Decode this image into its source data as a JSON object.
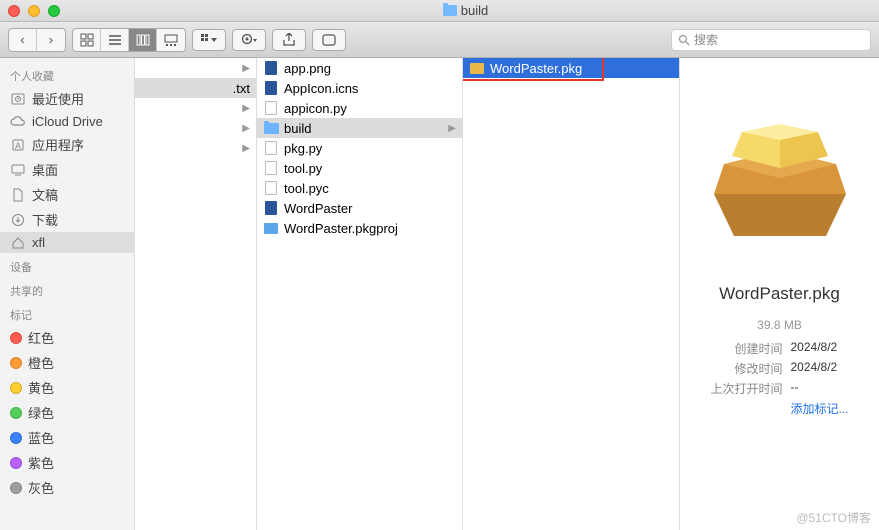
{
  "window": {
    "title": "build"
  },
  "toolbar": {
    "search_placeholder": "搜索"
  },
  "sidebar": {
    "sections": [
      {
        "heading": "个人收藏",
        "items": [
          {
            "label": "最近使用",
            "icon": "clock"
          },
          {
            "label": "iCloud Drive",
            "icon": "cloud"
          },
          {
            "label": "应用程序",
            "icon": "apps"
          },
          {
            "label": "桌面",
            "icon": "desktop"
          },
          {
            "label": "文稿",
            "icon": "doc"
          },
          {
            "label": "下载",
            "icon": "download"
          },
          {
            "label": "xfl",
            "icon": "home",
            "selected": true
          }
        ]
      },
      {
        "heading": "设备",
        "items": []
      },
      {
        "heading": "共享的",
        "items": []
      },
      {
        "heading": "标记",
        "items": [
          {
            "label": "红色",
            "color": "#ff5b51"
          },
          {
            "label": "橙色",
            "color": "#ff9a34"
          },
          {
            "label": "黄色",
            "color": "#ffcf2e"
          },
          {
            "label": "绿色",
            "color": "#56cf5a"
          },
          {
            "label": "蓝色",
            "color": "#3b82f6"
          },
          {
            "label": "紫色",
            "color": "#b560ff"
          },
          {
            "label": "灰色",
            "color": "#9e9e9e"
          }
        ]
      }
    ]
  },
  "columns": {
    "c1": [
      {
        "label": "",
        "arrow": true
      },
      {
        "label": ".txt",
        "arrow": false,
        "selected": true
      },
      {
        "label": "",
        "arrow": true
      },
      {
        "label": "",
        "arrow": true
      },
      {
        "label": "",
        "arrow": true
      }
    ],
    "c2": [
      {
        "label": "app.png",
        "icon": "blue"
      },
      {
        "label": "AppIcon.icns",
        "icon": "blue"
      },
      {
        "label": "appicon.py",
        "icon": "doc"
      },
      {
        "label": "build",
        "icon": "folder",
        "selected": true,
        "arrow": true
      },
      {
        "label": "pkg.py",
        "icon": "doc"
      },
      {
        "label": "tool.py",
        "icon": "doc"
      },
      {
        "label": "tool.pyc",
        "icon": "doc"
      },
      {
        "label": "WordPaster",
        "icon": "blue"
      },
      {
        "label": "WordPaster.pkgproj",
        "icon": "proj"
      }
    ],
    "c3": [
      {
        "label": "WordPaster.pkg",
        "icon": "pkg",
        "selected": true,
        "highlight": true
      }
    ]
  },
  "preview": {
    "name": "WordPaster.pkg",
    "size": "39.8 MB",
    "created_label": "创建时间",
    "created": "2024/8/2",
    "modified_label": "修改时间",
    "modified": "2024/8/2",
    "opened_label": "上次打开时间",
    "opened": "--",
    "add_tag": "添加标记..."
  },
  "watermark": "@51CTO博客"
}
